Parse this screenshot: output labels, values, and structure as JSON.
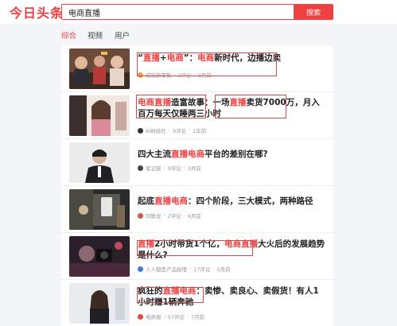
{
  "app": {
    "logo": "今日头条"
  },
  "search": {
    "query": "电商直播",
    "button_label": "搜索"
  },
  "tabs": [
    {
      "label": "综合",
      "active": true
    },
    {
      "label": "视频",
      "active": false
    },
    {
      "label": "用户",
      "active": false
    }
  ],
  "results": [
    {
      "title_parts": [
        {
          "text": "“"
        },
        {
          "text": "直播",
          "hl": true
        },
        {
          "text": "+"
        },
        {
          "text": "电商",
          "hl": true
        },
        {
          "text": "”："
        },
        {
          "text": "电商",
          "hl": true
        },
        {
          "text": "新时代，边播边卖"
        }
      ],
      "source": "成就新零售",
      "comments": "2评论",
      "time": "3月前",
      "icon_color": "#e8a24a"
    },
    {
      "title_parts": [
        {
          "text": "电商直播",
          "hl": true
        },
        {
          "text": "造富故事：一场"
        },
        {
          "text": "直播",
          "hl": true
        },
        {
          "text": "卖货7000万，月入百万每天仅睡两三小时"
        }
      ],
      "source": "AI财经社",
      "comments": "9评论",
      "time": "1年前",
      "icon_color": "#333333"
    },
    {
      "title_parts": [
        {
          "text": "四大主流"
        },
        {
          "text": "直播电商",
          "hl": true
        },
        {
          "text": "平台的差别在哪?"
        }
      ],
      "source": "笔记侠",
      "comments": "9评论",
      "time": "3月前",
      "icon_color": "#444444"
    },
    {
      "title_parts": [
        {
          "text": "起底"
        },
        {
          "text": "直播电商",
          "hl": true
        },
        {
          "text": "：四个阶段，三大模式，两种路径"
        }
      ],
      "source": "同联龙",
      "comments": "2评论",
      "time": "6月前",
      "icon_color": "#d9534f"
    },
    {
      "title_parts": [
        {
          "text": "直播",
          "hl": true
        },
        {
          "text": "2小时带货1个亿，"
        },
        {
          "text": "电商直播",
          "hl": true
        },
        {
          "text": "大火后的发展趋势是什么?"
        }
      ],
      "source": "人人都是产品经理",
      "comments": "17评论",
      "time": "5月前",
      "icon_color": "#3a7bd5"
    },
    {
      "title_parts": [
        {
          "text": "疯狂的"
        },
        {
          "text": "直播电商",
          "hl": true
        },
        {
          "text": "：卖惨、卖良心、卖假货！有人1小时赚1辆奔驰"
        }
      ],
      "source": "电商报",
      "comments": "57评论",
      "time": "7月前",
      "icon_color": "#e04b3c"
    }
  ]
}
